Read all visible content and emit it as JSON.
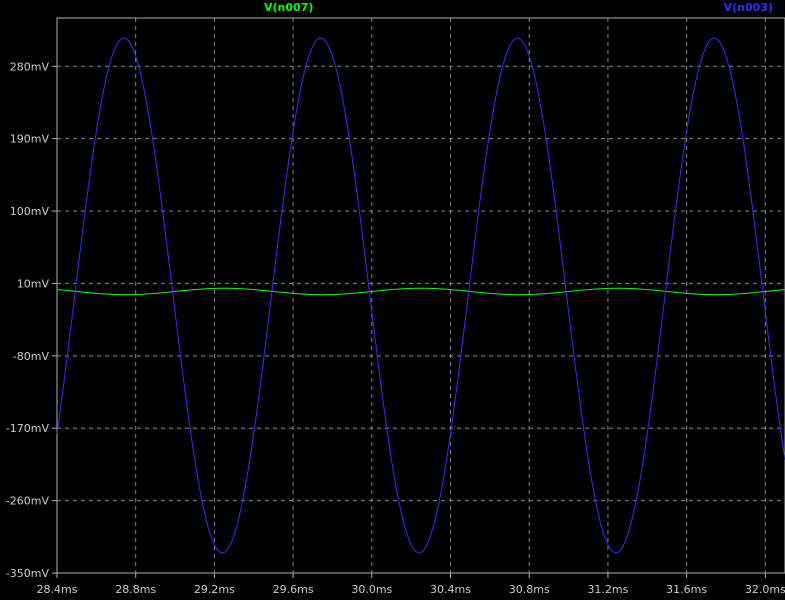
{
  "chart_data": {
    "type": "line",
    "title": "",
    "xlabel": "",
    "ylabel": "",
    "xlim": [
      28.4,
      32.1
    ],
    "ylim": [
      -350,
      340
    ],
    "x_unit": "ms",
    "y_unit": "mV",
    "grid": true,
    "xticks": [
      28.4,
      28.8,
      29.2,
      29.6,
      30.0,
      30.4,
      30.8,
      31.2,
      31.6,
      32.0
    ],
    "xtick_labels": [
      "28.4ms",
      "28.8ms",
      "29.2ms",
      "29.6ms",
      "30.0ms",
      "30.4ms",
      "30.8ms",
      "31.2ms",
      "31.6ms",
      "32.0ms"
    ],
    "yticks": [
      280,
      190,
      100,
      10,
      -80,
      -170,
      -260,
      -350
    ],
    "ytick_labels": [
      "280mV",
      "190mV",
      "100mV",
      "10mV",
      "-80mV",
      "-170mV",
      "-260mV",
      "-350mV"
    ],
    "series": [
      {
        "name": "V(n007)",
        "color": "#00ff00",
        "shape": "sine",
        "offset": 0,
        "amplitude": 4,
        "period": 1.0,
        "peak_time": 29.25
      },
      {
        "name": "V(n003)",
        "color": "#3030ff",
        "shape": "sine",
        "offset": -5,
        "amplitude": 320,
        "period": 1.0,
        "peak_time": 28.74
      }
    ]
  }
}
